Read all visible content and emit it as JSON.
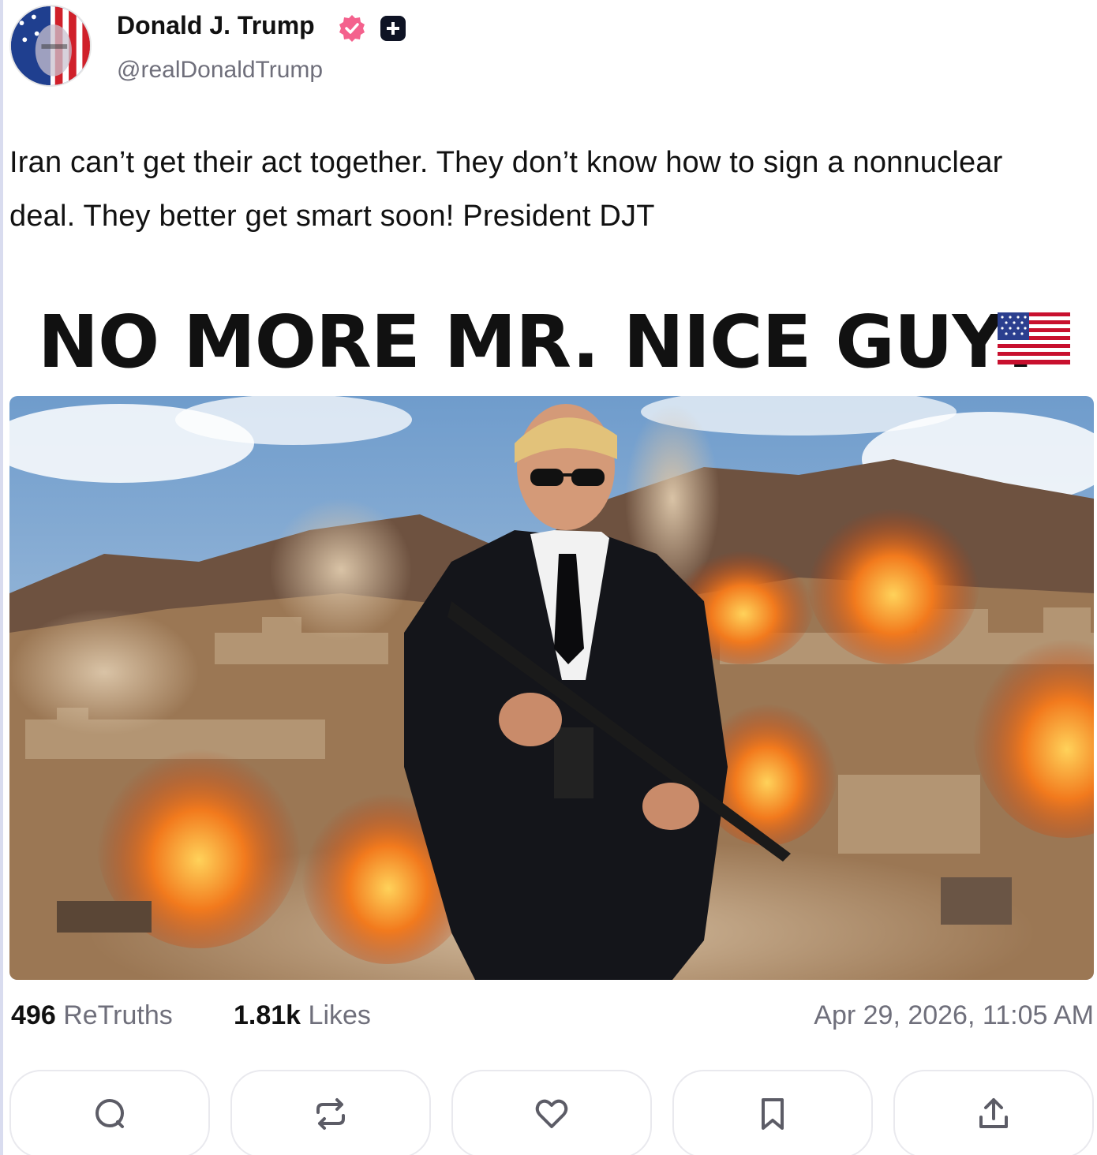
{
  "author": {
    "name": "Donald J. Trump",
    "handle": "@realDonaldTrump",
    "avatar_icon": "avatar",
    "badges": [
      "verified-icon",
      "plus-icon"
    ],
    "verified_color": "#f4618d"
  },
  "post": {
    "text": "Iran can’t get their act together. They don’t know how to sign a nonnuclear deal. They better get smart soon! President DJT"
  },
  "media": {
    "headline": "NO MORE MR. NICE GUY!",
    "headline_emoji_icon": "us-flag-icon",
    "image_icon": "post-image"
  },
  "stats": {
    "retruths_count": "496",
    "retruths_label": "ReTruths",
    "likes_count": "1.81k",
    "likes_label": "Likes",
    "timestamp": "Apr 29, 2026, 11:05 AM"
  },
  "actions": [
    {
      "icon": "comment-icon"
    },
    {
      "icon": "retruth-icon"
    },
    {
      "icon": "heart-icon"
    },
    {
      "icon": "bookmark-icon"
    },
    {
      "icon": "share-icon"
    }
  ],
  "colors": {
    "text": "#111111",
    "muted": "#6f6f7b",
    "border": "#e9e9ee",
    "icon": "#5c5c66"
  }
}
